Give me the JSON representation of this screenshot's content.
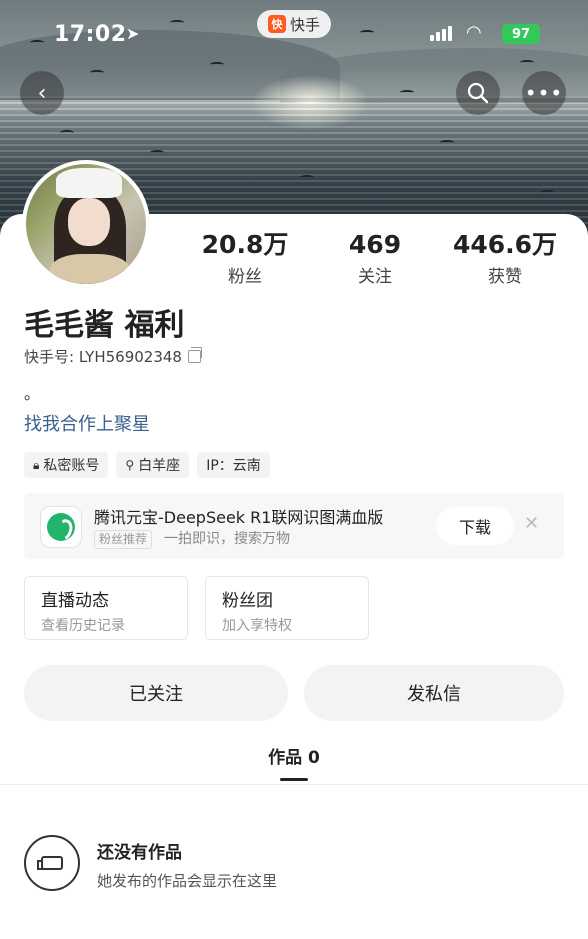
{
  "status_bar": {
    "time": "17:02",
    "app_name": "快手",
    "battery": "97"
  },
  "header": {
    "back_icon": "chevron-left-icon",
    "search_icon": "search-icon",
    "more_icon": "more-icon"
  },
  "profile": {
    "name": "毛毛酱 福利",
    "kuaishou_id": "快手号: LYH56902348",
    "bio": "。",
    "link": "找我合作上聚星",
    "stats": [
      {
        "value": "20.8万",
        "label": "粉丝"
      },
      {
        "value": "469",
        "label": "关注"
      },
      {
        "value": "446.6万",
        "label": "获赞"
      }
    ],
    "tags": [
      {
        "icon": "lock-icon",
        "text": "私密账号"
      },
      {
        "icon": "star-sign-icon",
        "text": "白羊座"
      },
      {
        "icon": "",
        "text": "IP：云南"
      }
    ]
  },
  "promo": {
    "title": "腾讯元宝-DeepSeek R1联网识图满血版",
    "badge": "粉丝推荐",
    "subtitle": "一拍即识，搜索万物",
    "download_label": "下载",
    "close": "✕"
  },
  "entries": [
    {
      "title": "直播动态",
      "subtitle": "查看历史记录"
    },
    {
      "title": "粉丝团",
      "subtitle": "加入享特权"
    }
  ],
  "actions": {
    "follow_label": "已关注",
    "message_label": "发私信"
  },
  "tabs": {
    "works_label": "作品 0"
  },
  "empty": {
    "title": "还没有作品",
    "subtitle": "她发布的作品会显示在这里"
  },
  "colors": {
    "link": "#3a5f91",
    "battery": "#34c759",
    "app_logo": "#ff5a1f"
  }
}
